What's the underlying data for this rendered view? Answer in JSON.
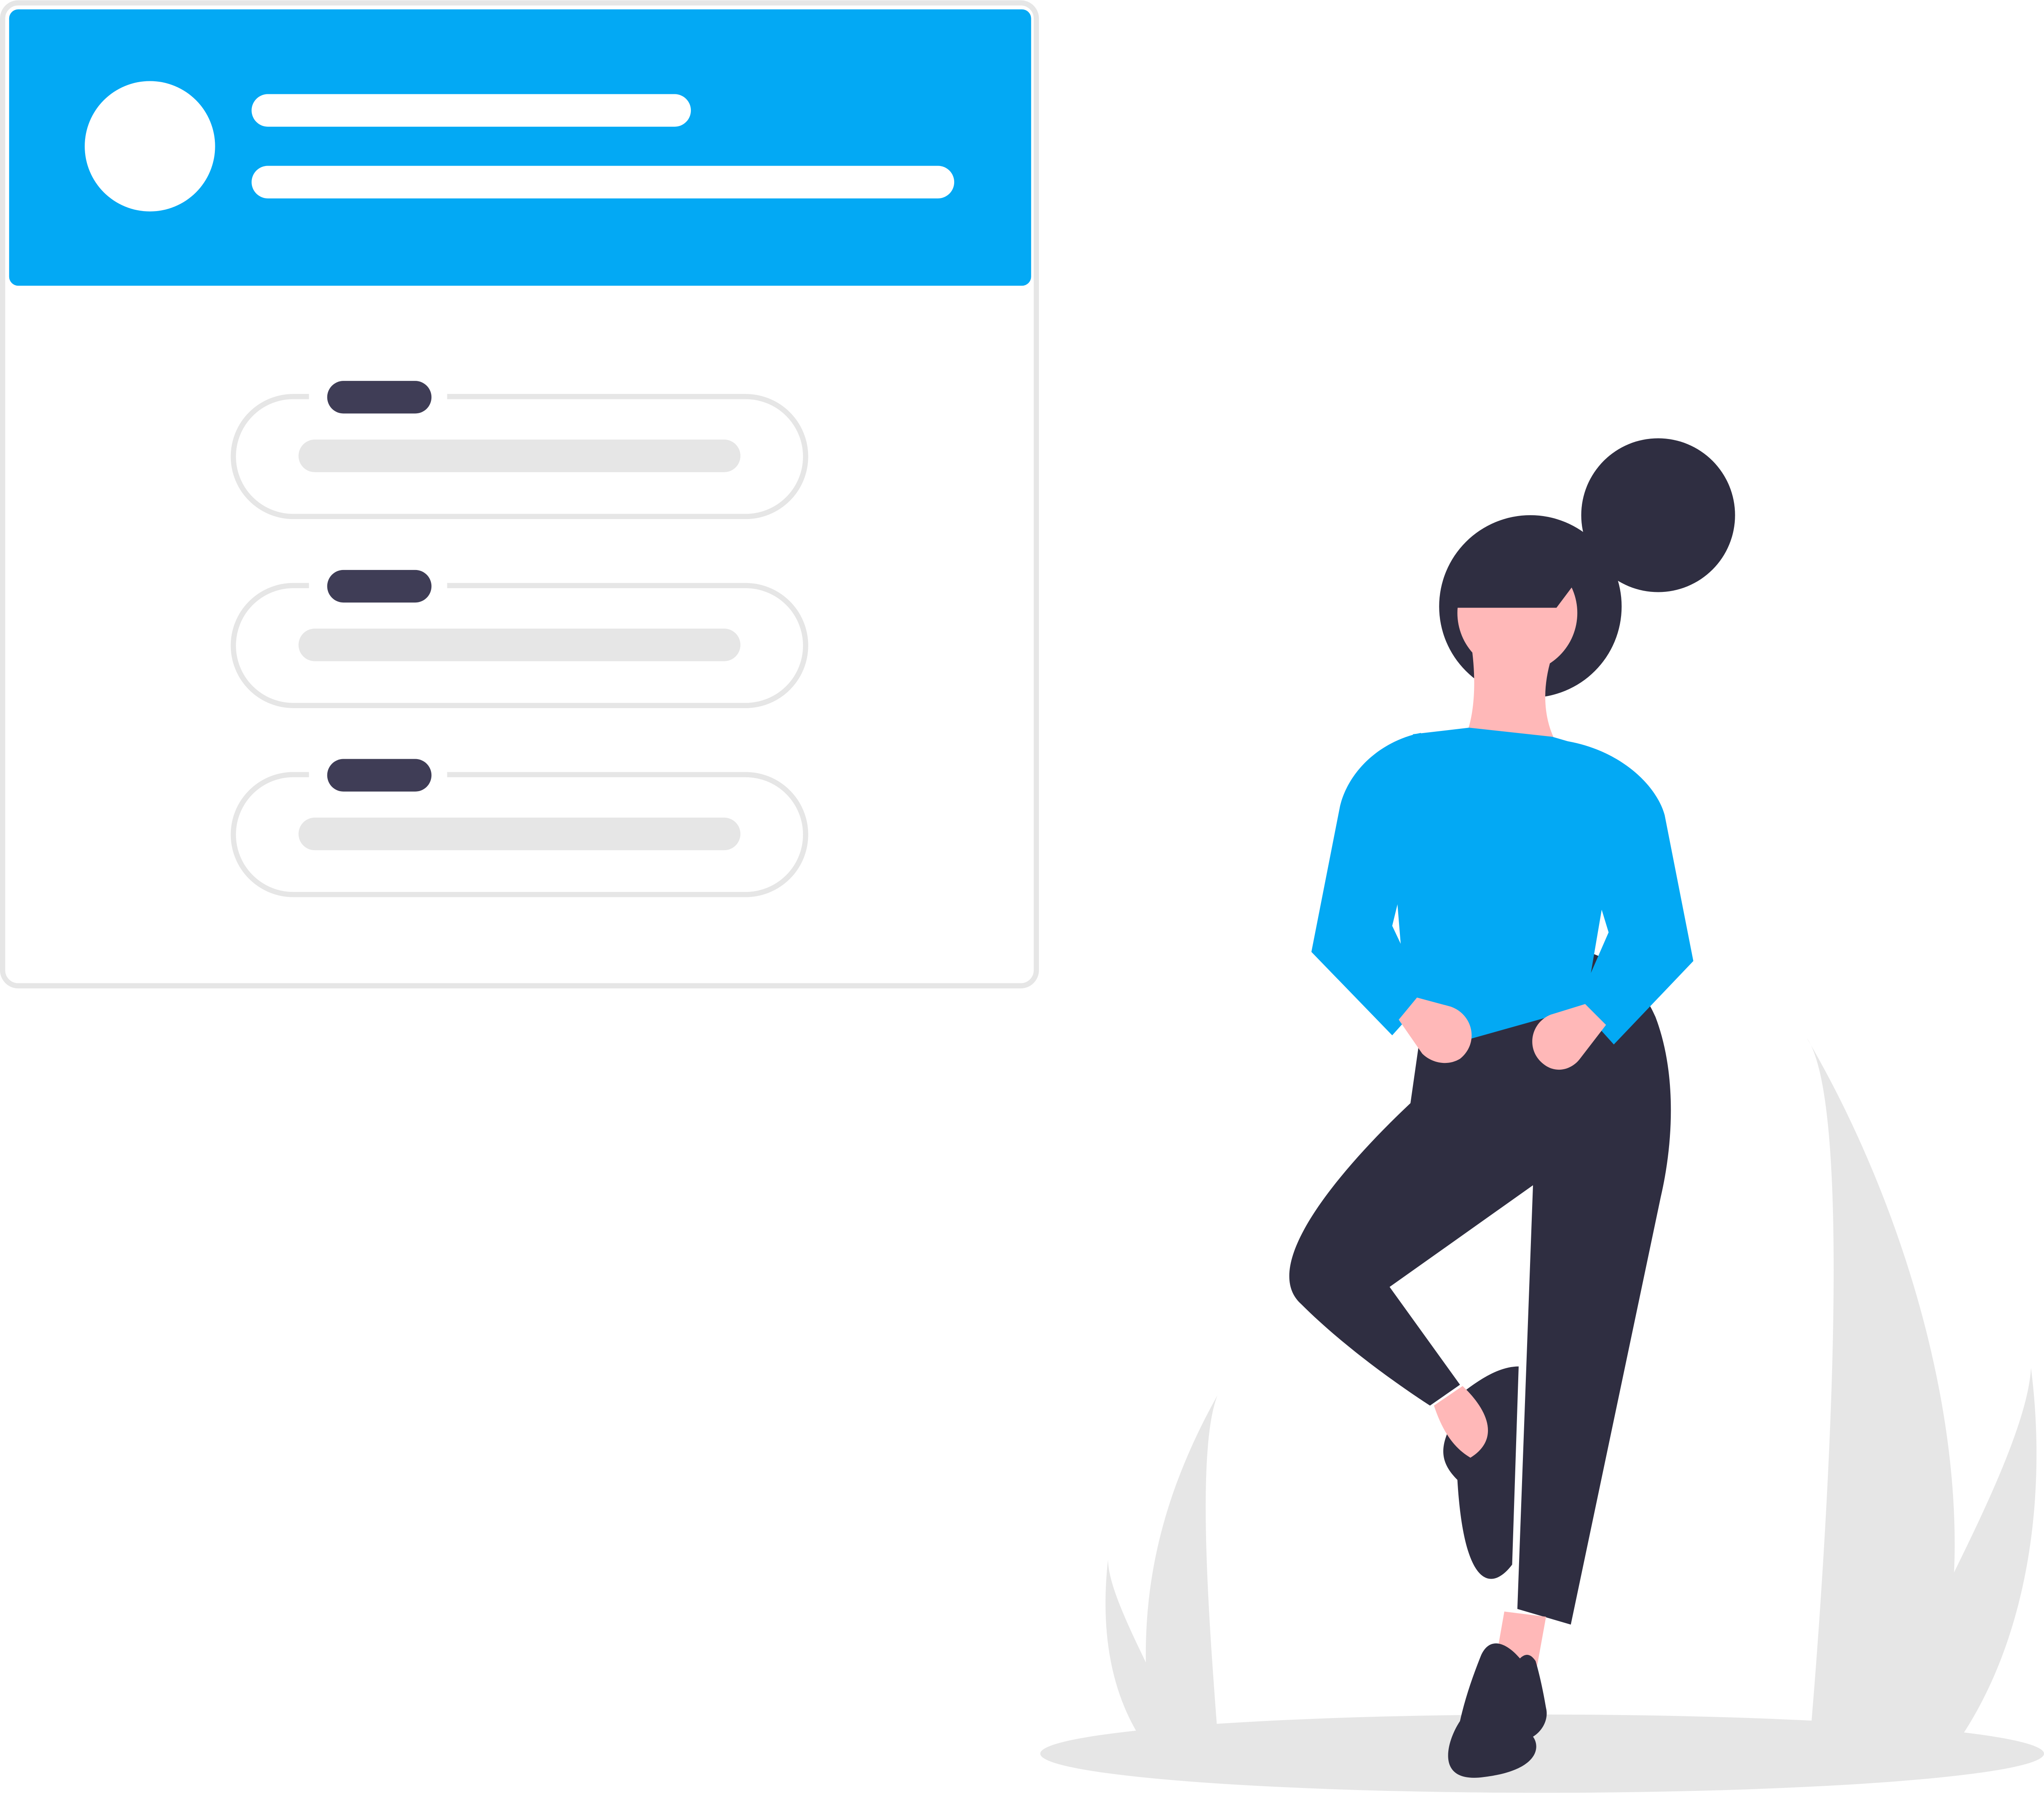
{
  "colors": {
    "accent": "#03A9F4",
    "dark": "#2F2E41",
    "pill_dark": "#3F3D56",
    "light_gray": "#E6E6E6",
    "skin": "#FFB8B8",
    "white": "#FFFFFF"
  },
  "profile_card": {
    "icons": [
      "avatar-placeholder-icon"
    ],
    "header_text_lines": 2
  },
  "list": {
    "item_count": 3
  },
  "illustration": {
    "icons": [
      "woman-figure-icon",
      "plant-left-icon",
      "plant-right-icon",
      "ground-shadow-icon"
    ]
  }
}
